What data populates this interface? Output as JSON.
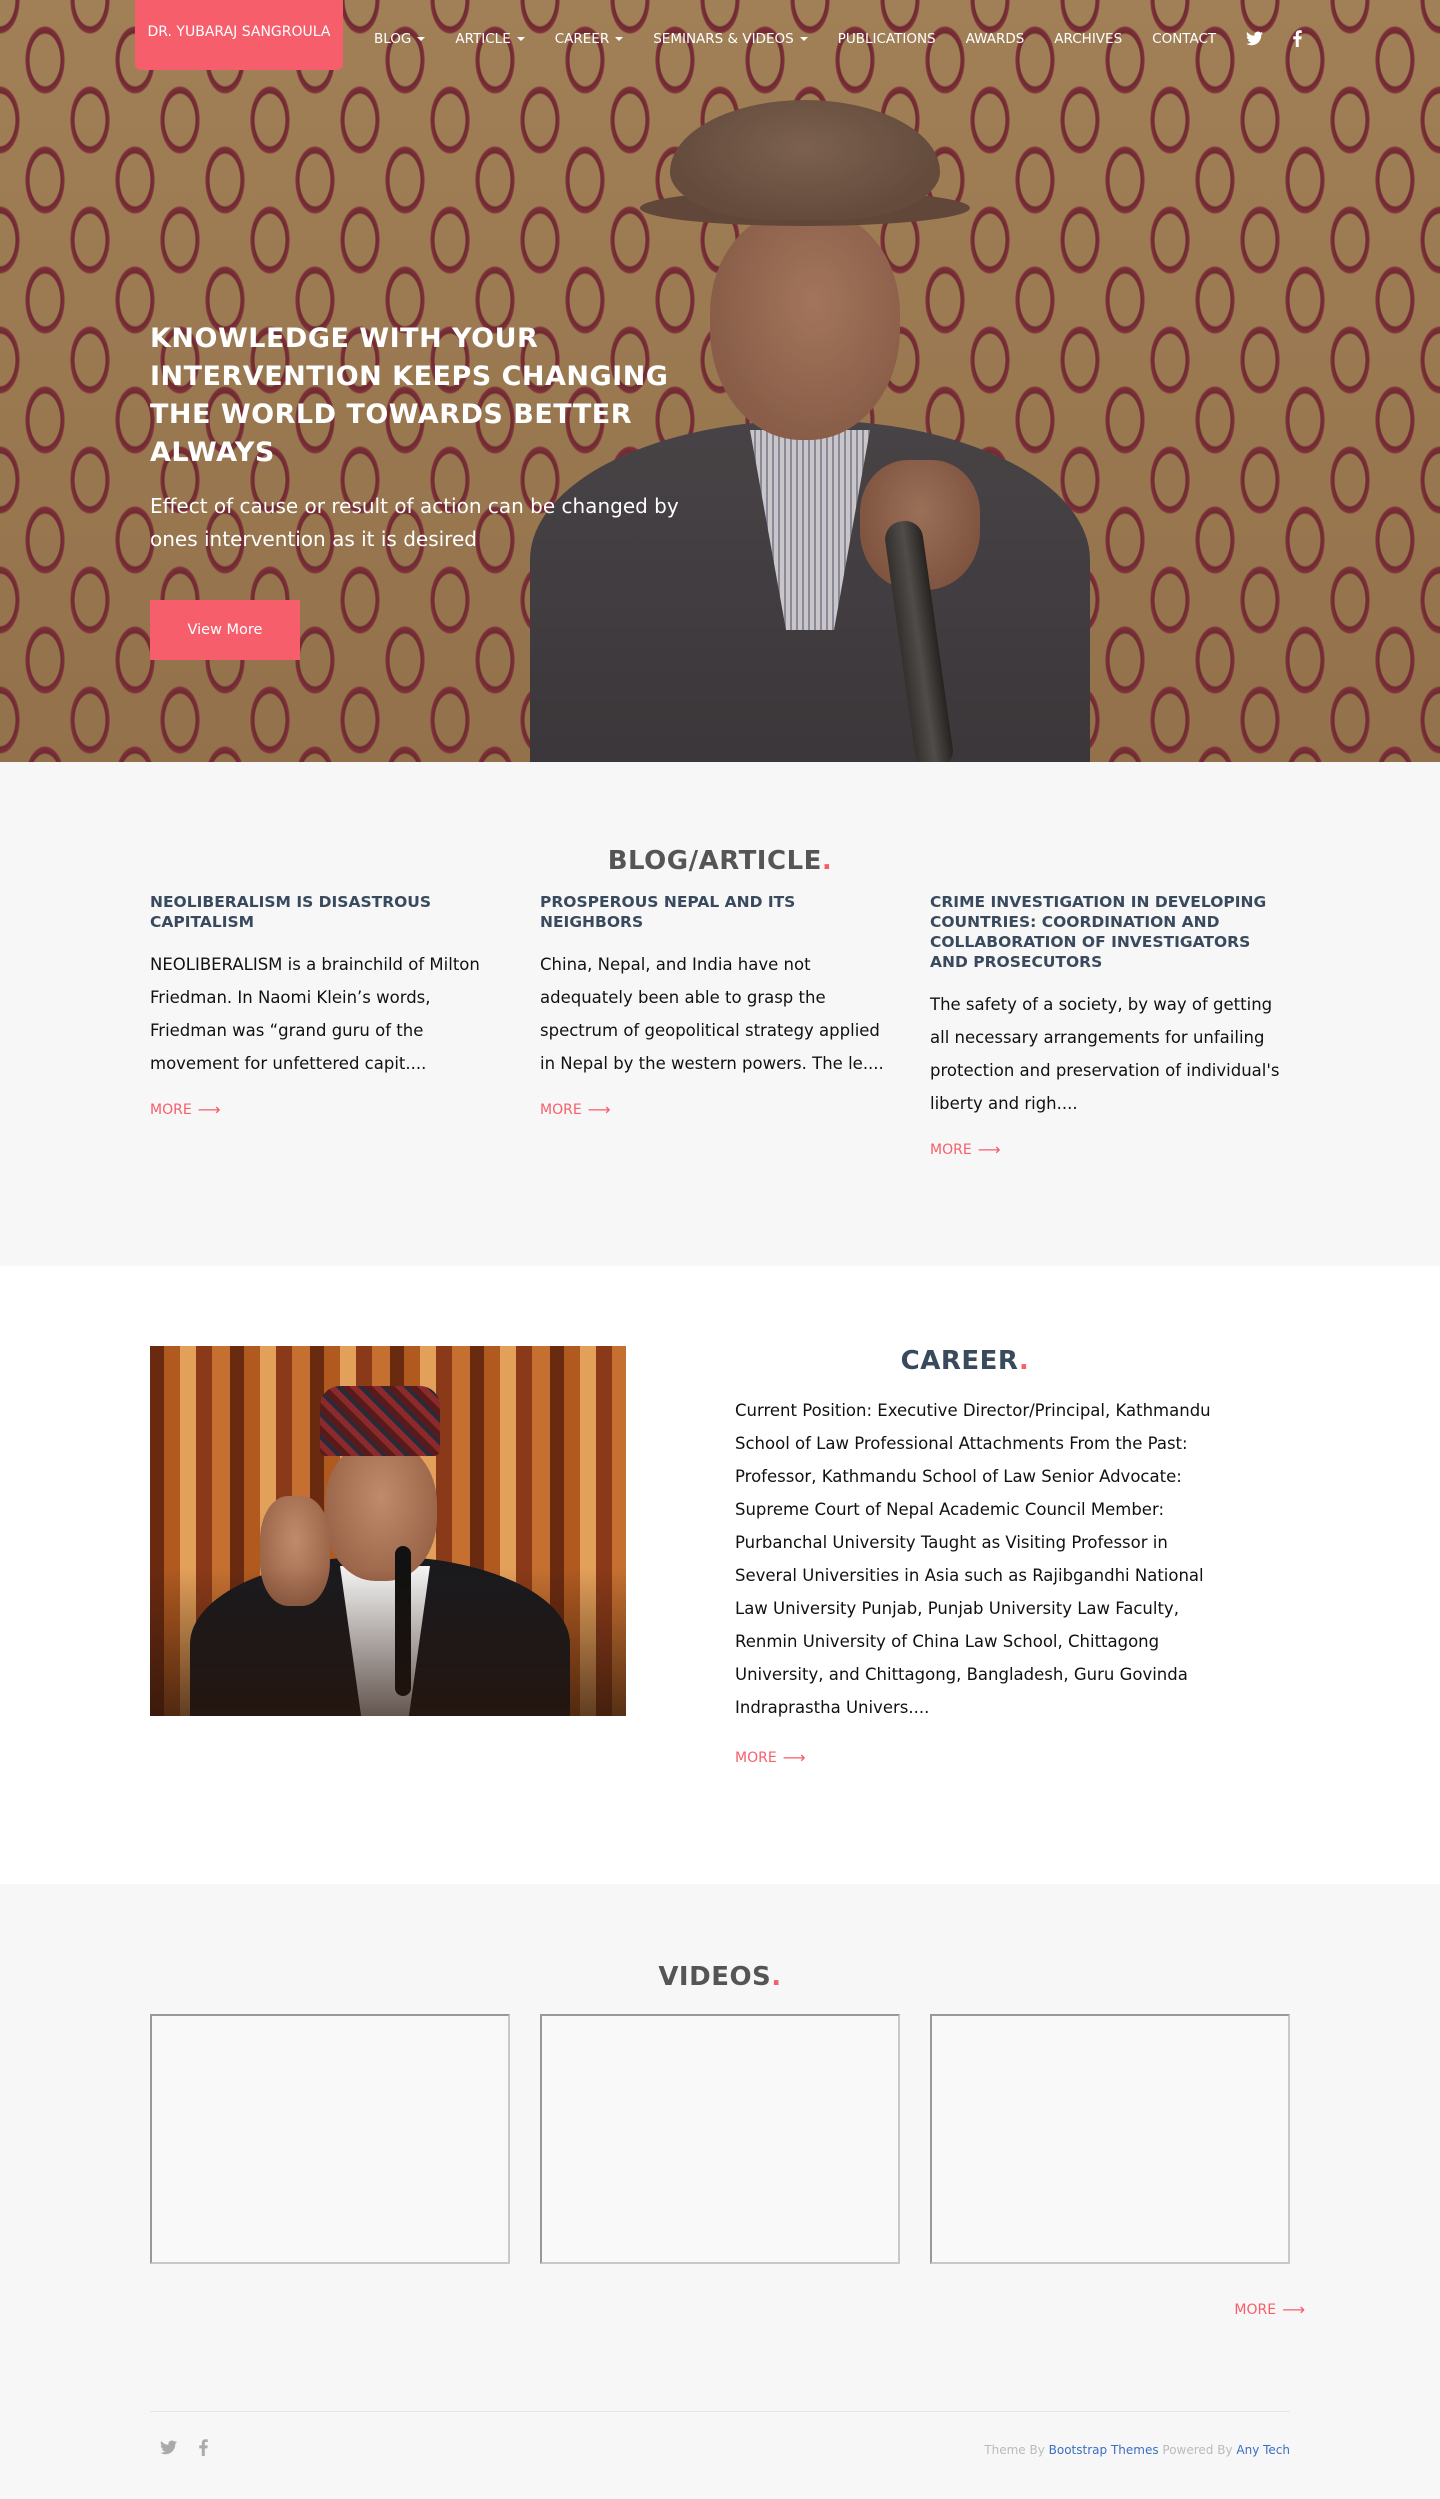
{
  "brand": {
    "name": "DR. YUBARAJ SANGROULA"
  },
  "nav": {
    "items": [
      {
        "label": "BLOG",
        "dropdown": true
      },
      {
        "label": "ARTICLE",
        "dropdown": true
      },
      {
        "label": "CAREER",
        "dropdown": true
      },
      {
        "label": "SEMINARS & VIDEOS",
        "dropdown": true
      },
      {
        "label": "PUBLICATIONS",
        "dropdown": false
      },
      {
        "label": "AWARDS",
        "dropdown": false
      },
      {
        "label": "ARCHIVES",
        "dropdown": false
      },
      {
        "label": "CONTACT",
        "dropdown": false
      }
    ],
    "icons": [
      "twitter-icon",
      "facebook-icon"
    ]
  },
  "hero": {
    "title": "KNOWLEDGE WITH YOUR INTERVENTION KEEPS CHANGING THE WORLD TOWARDS BETTER ALWAYS",
    "subtitle": "Effect of cause or result of action can be changed by ones intervention as it is desired",
    "button_label": "View More"
  },
  "blog": {
    "title": "BLOG/ARTICLE",
    "title_dot": ".",
    "posts": [
      {
        "title": "NEOLIBERALISM IS DISASTROUS CAPITALISM",
        "excerpt": "NEOLIBERALISM is a brainchild of Milton Friedman. In Naomi Klein’s words, Friedman was “grand guru of the movement for unfettered capit....",
        "more_label": "MORE",
        "more_arrow": "⟶"
      },
      {
        "title": "PROSPEROUS NEPAL AND ITS NEIGHBORS",
        "excerpt": "China, Nepal, and India have not adequately been able to grasp the spectrum of geopolitical strategy applied in Nepal by the western powers. The le....",
        "more_label": "MORE",
        "more_arrow": "⟶"
      },
      {
        "title": "CRIME INVESTIGATION IN DEVELOPING COUNTRIES: COORDINATION AND COLLABORATION OF INVESTIGATORS AND PROSECUTORS",
        "excerpt": "The safety of a society, by way of getting all necessary arrangements for unfailing protection and preservation of individual's liberty and righ....",
        "more_label": "MORE",
        "more_arrow": "⟶"
      }
    ]
  },
  "career": {
    "title": "CAREER",
    "title_dot": ".",
    "text": "Current Position: Executive Director/Principal, Kathmandu School of Law     Professional Attachments From the Past: Professor, Kathmandu School of Law   Senior Advocate: Supreme Court of Nepal   Academic Council Member: Purbanchal University    Taught as Visiting Professor in Several Universities in Asia such as Rajibgandhi National Law University Punjab, Punjab University Law Faculty, Renmin University of China Law School, Chittagong University, and Chittagong, Bangladesh, Guru Govinda Indraprastha Univers....",
    "more_label": "MORE",
    "more_arrow": "⟶"
  },
  "videos": {
    "title": "VIDEOS",
    "title_dot": ".",
    "more_label": "MORE",
    "more_arrow": "⟶"
  },
  "footer": {
    "theme_by_prefix": "Theme By ",
    "theme_link": "Bootstrap Themes",
    "powered_by_prefix": " Powered By ",
    "powered_link": "Any Tech",
    "icons": [
      "twitter-icon",
      "facebook-icon"
    ]
  },
  "colors": {
    "accent": "#f65e6b",
    "heading_dark": "#3a4a5e",
    "section_bg": "#f7f7f7"
  }
}
